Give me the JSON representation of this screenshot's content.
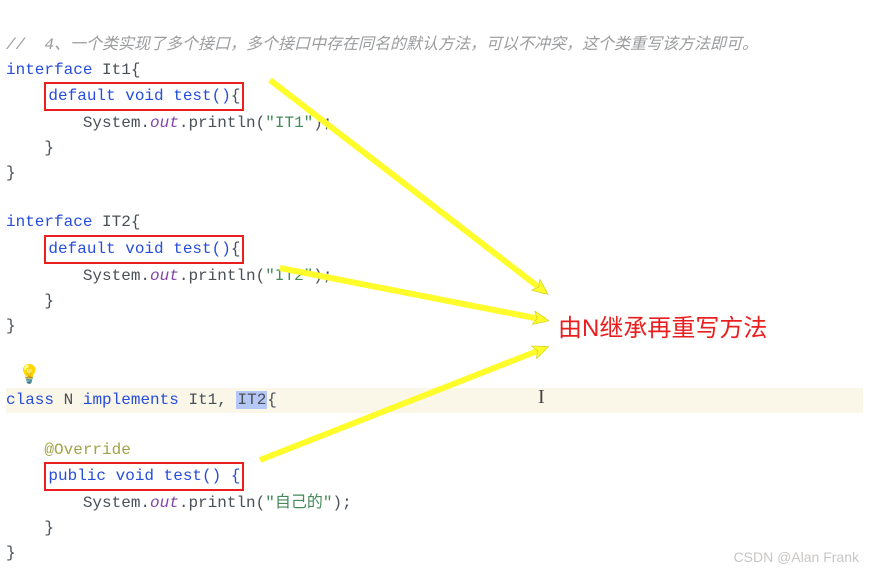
{
  "comment_line": "//  4、一个类实现了多个接口，多个接口中存在同名的默认方法，可以不冲突，这个类重写该方法即可。",
  "it1": {
    "decl_kw": "interface",
    "name": "It1",
    "method_sig": "default void test()",
    "print_prefix": "System.",
    "print_out": "out",
    "print_call": ".println(",
    "print_str": "\"IT1\"",
    "print_end": ");"
  },
  "it2": {
    "decl_kw": "interface",
    "name": "IT2",
    "method_sig": "default void test()",
    "print_prefix": "System.",
    "print_out": "out",
    "print_call": ".println(",
    "print_str": "\"IT2\"",
    "print_end": ");"
  },
  "n": {
    "class_kw": "class",
    "name": "N",
    "impl_kw": "implements",
    "impl1": "It1",
    "impl2": "IT2",
    "override": "@Override",
    "method_sig": "public void test() {",
    "print_prefix": "System.",
    "print_out": "out",
    "print_call": ".println(",
    "print_str": "\"自己的\"",
    "print_end": ");"
  },
  "annotation": "由N继承再重写方法",
  "bulb_icon": "💡",
  "cursor_icon": "I",
  "watermark": "CSDN @Alan Frank",
  "colors": {
    "red": "#e91e1e",
    "arrow": "#fffc2b"
  }
}
